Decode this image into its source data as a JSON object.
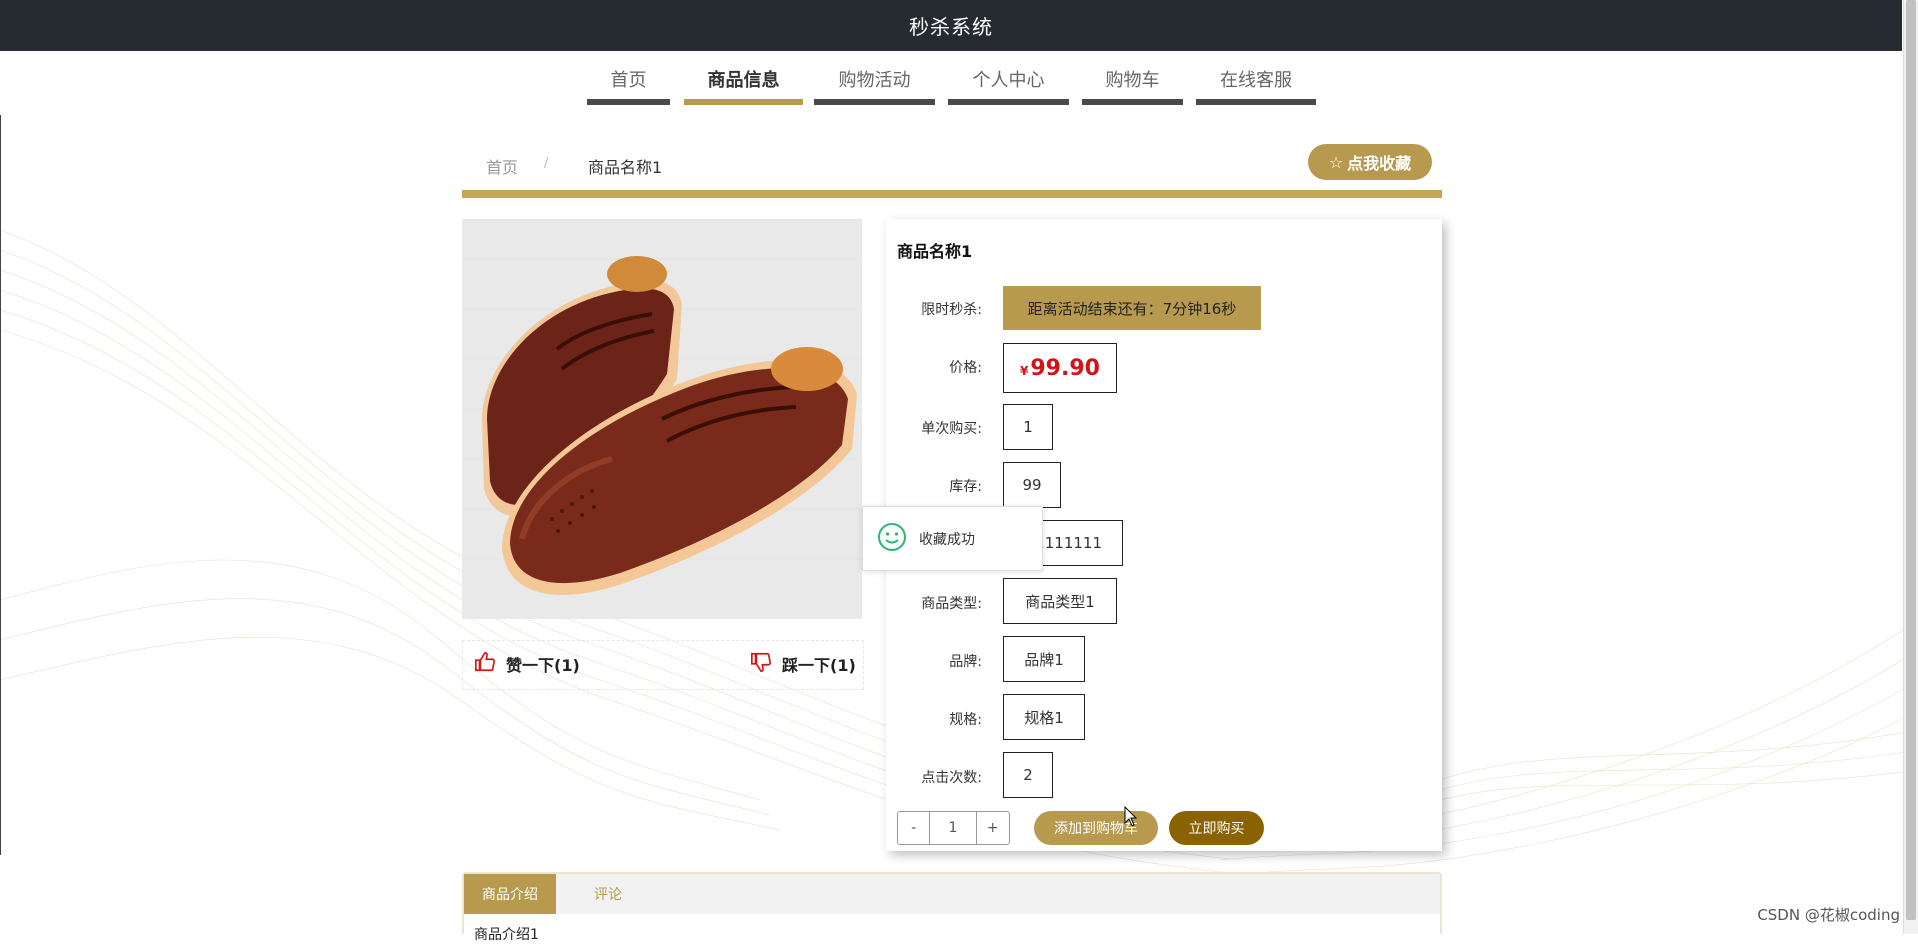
{
  "header": {
    "title": "秒杀系统"
  },
  "nav": {
    "items": [
      {
        "label": "首页"
      },
      {
        "label": "商品信息"
      },
      {
        "label": "购物活动"
      },
      {
        "label": "个人中心"
      },
      {
        "label": "购物车"
      },
      {
        "label": "在线客服"
      }
    ],
    "active_index": 1
  },
  "breadcrumb": {
    "home": "首页",
    "separator": "/",
    "current": "商品名称1"
  },
  "favorite_button": {
    "label": "点我收藏",
    "icon": "star-outline-icon"
  },
  "votes": {
    "like": {
      "label": "赞一下(1)",
      "icon": "thumbs-up-icon"
    },
    "dislike": {
      "label": "踩一下(1)",
      "icon": "thumbs-down-icon"
    }
  },
  "product": {
    "name": "商品名称1",
    "fields": {
      "flash_sale": {
        "label": "限时秒杀:",
        "value": "距离活动结束还有：7分钟16秒"
      },
      "price": {
        "label": "价格:",
        "currency": "¥",
        "value": "99.90"
      },
      "per_purchase": {
        "label": "单次购买:",
        "value": "1"
      },
      "stock": {
        "label": "库存:",
        "value": "99"
      },
      "hidden_field": {
        "value": "11111111"
      },
      "category": {
        "label": "商品类型:",
        "value": "商品类型1"
      },
      "brand": {
        "label": "品牌:",
        "value": "品牌1"
      },
      "spec": {
        "label": "规格:",
        "value": "规格1"
      },
      "clicks": {
        "label": "点击次数:",
        "value": "2"
      }
    }
  },
  "quantity": {
    "minus": "-",
    "value": "1",
    "plus": "+"
  },
  "actions": {
    "add_to_cart": "添加到购物车",
    "buy_now": "立即购买"
  },
  "toast": {
    "message": "收藏成功",
    "icon": "smile-icon"
  },
  "tabs": [
    {
      "label": "商品介绍"
    },
    {
      "label": "评论"
    }
  ],
  "tab_content": "商品介绍1",
  "watermark": "CSDN @花椒coding",
  "colors": {
    "accent": "#b89a4e",
    "buy": "#8a6200",
    "price": "#d1141a",
    "header": "#262a31"
  }
}
